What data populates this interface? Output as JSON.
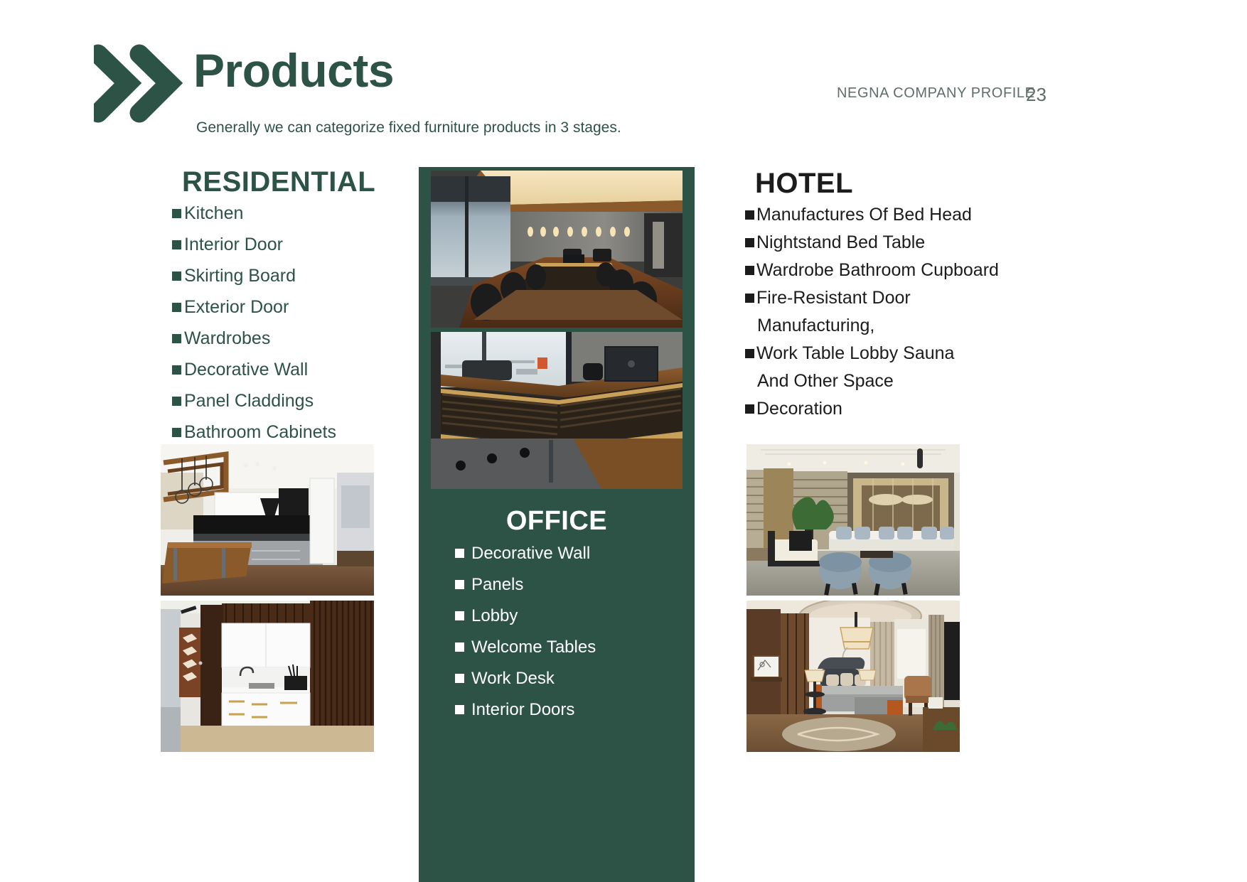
{
  "header": {
    "title": "Products",
    "subtitle": "Generally we can categorize fixed furniture products in 3 stages.",
    "doc_meta": "NEGNA COMPANY PROFILE",
    "page_number": "23",
    "chevron_icon": "double-chevron-right-icon"
  },
  "colors": {
    "brand_green": "#2C5346",
    "meta_gray": "#5F6E6B",
    "hotel_black": "#1C1C1C",
    "white": "#FFFFFF"
  },
  "residential": {
    "title": "RESIDENTIAL",
    "items": [
      "Kitchen",
      "Interior Door",
      "Skirting Board",
      "Exterior Door",
      "Wardrobes",
      "Decorative Wall",
      "Panel Claddings",
      "Bathroom Cabinets"
    ],
    "images": [
      {
        "name": "residential-kitchen-photo-1",
        "caption": "Modern kitchen with wooden island and white cabinets"
      },
      {
        "name": "residential-kitchen-photo-2",
        "caption": "White gloss kitchen with dark slatted wood wall"
      }
    ]
  },
  "office": {
    "title": "OFFICE",
    "items": [
      "Decorative Wall",
      "Panels",
      "Lobby",
      "Welcome Tables",
      "Work Desk",
      "Interior Doors"
    ],
    "images": [
      {
        "name": "office-meeting-room-photo",
        "caption": "Boardroom with long wooden conference table"
      },
      {
        "name": "office-reception-desk-photo",
        "caption": "Reception desk with laptop and slatted wood front"
      }
    ]
  },
  "hotel": {
    "title": "HOTEL",
    "items": [
      {
        "text": "Manufactures Of Bed Head",
        "bullet": true
      },
      {
        "text": "Nightstand Bed Table",
        "bullet": true
      },
      {
        "text": "Wardrobe Bathroom Cupboard",
        "bullet": true
      },
      {
        "text": "Fire-Resistant Door",
        "bullet": true
      },
      {
        "text": "Manufacturing,",
        "bullet": false
      },
      {
        "text": "Work Table Lobby Sauna",
        "bullet": true
      },
      {
        "text": "And Other Space",
        "bullet": false
      },
      {
        "text": "Decoration",
        "bullet": true
      }
    ],
    "images": [
      {
        "name": "hotel-lobby-photo",
        "caption": "Hotel lounge with grey armchairs and sofa"
      },
      {
        "name": "hotel-bedroom-photo",
        "caption": "Hotel guest bedroom with pendant lamp"
      }
    ]
  }
}
